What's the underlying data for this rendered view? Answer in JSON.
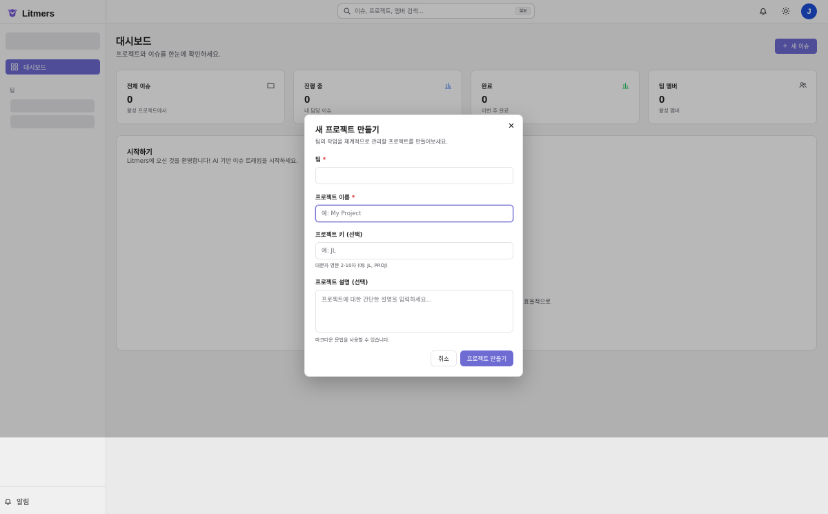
{
  "app": {
    "brand": "Litmers"
  },
  "sidebar": {
    "nav_dashboard": "대시보드",
    "team_section_label": "팀",
    "footer_notifications": "알림"
  },
  "topbar": {
    "search_placeholder": "이슈, 프로젝트, 멤버 검색...",
    "search_shortcut": "⌘K",
    "avatar_initial": "J"
  },
  "page": {
    "title": "대시보드",
    "subtitle": "프로젝트와 이슈를 한눈에 확인하세요.",
    "new_issue_label": "새 이슈"
  },
  "stats": [
    {
      "title": "전체 이슈",
      "value": "0",
      "sub": "활성 프로젝트에서",
      "icon": "folder-icon",
      "icon_color": "#52525b"
    },
    {
      "title": "진행 중",
      "value": "0",
      "sub": "내 담당 이슈",
      "icon": "bar-chart-icon",
      "icon_color": "#3b82f6"
    },
    {
      "title": "완료",
      "value": "0",
      "sub": "이번 주 완료",
      "icon": "bar-chart-icon",
      "icon_color": "#22c55e"
    },
    {
      "title": "팀 멤버",
      "value": "0",
      "sub": "활성 멤버",
      "icon": "users-icon",
      "icon_color": "#52525b"
    }
  ],
  "start": {
    "title": "시작하기",
    "description": "Litmers에 오신 것을 환영합니다! AI 기반 이슈 트래킹을 시작하세요.",
    "peek_text": "효율적으로"
  },
  "modal": {
    "title": "새 프로젝트 만들기",
    "description": "팀의 작업을 체계적으로 관리할 프로젝트를 만들어보세요.",
    "team_label": "팀",
    "team_value": "",
    "name_label": "프로젝트 이름",
    "name_placeholder": "예: My Project",
    "key_label": "프로젝트 키 (선택)",
    "key_placeholder": "예: JL",
    "key_hint": "대문자 영문 2-10자 (예: JL, PROJ)",
    "desc_label": "프로젝트 설명 (선택)",
    "desc_placeholder": "프로젝트에 대한 간단한 설명을 입력하세요...",
    "desc_hint": "마크다운 문법을 사용할 수 있습니다.",
    "required_mark": "*",
    "cancel_label": "취소",
    "create_label": "프로젝트 만들기"
  },
  "colors": {
    "accent": "#6e6bd3",
    "required": "#dc2626"
  }
}
